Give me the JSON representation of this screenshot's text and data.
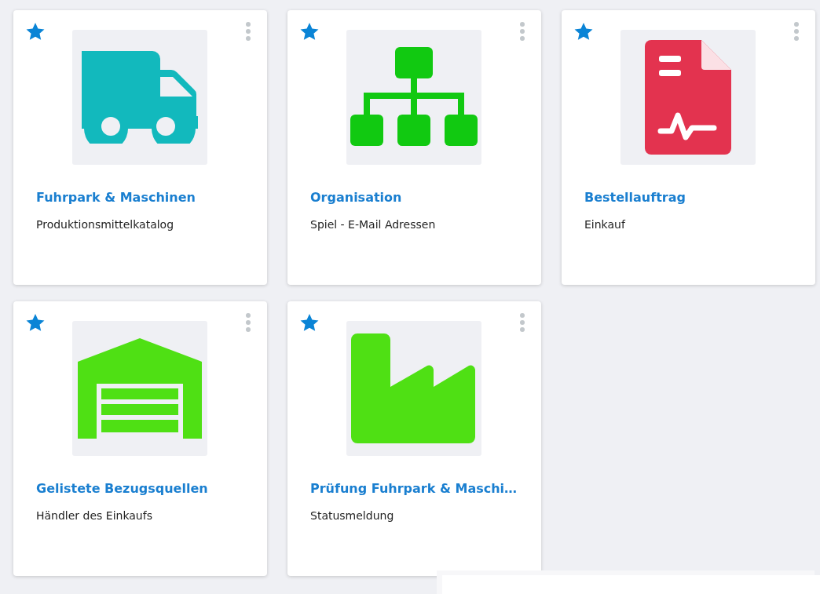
{
  "tiles": [
    {
      "title": "Fuhrpark & Maschinen",
      "subtitle": "Produktionsmittelkatalog",
      "kind": "truck",
      "color": "#12b9bd",
      "favorite": true
    },
    {
      "title": "Organisation",
      "subtitle": "Spiel - E-Mail Adressen",
      "kind": "hierarchy",
      "color": "#11c911",
      "favorite": true
    },
    {
      "title": "Bestellauftrag",
      "subtitle": "Einkauf",
      "kind": "document",
      "color": "#e3334f",
      "favorite": true
    },
    {
      "title": "Gelistete Bezugsquellen",
      "subtitle": "Händler des Einkaufs",
      "kind": "warehouse",
      "color": "#4fe014",
      "favorite": true
    },
    {
      "title": "Prüfung Fuhrpark & Maschi…",
      "subtitle": "Statusmeldung",
      "kind": "factory",
      "color": "#4fe014",
      "favorite": true
    }
  ]
}
